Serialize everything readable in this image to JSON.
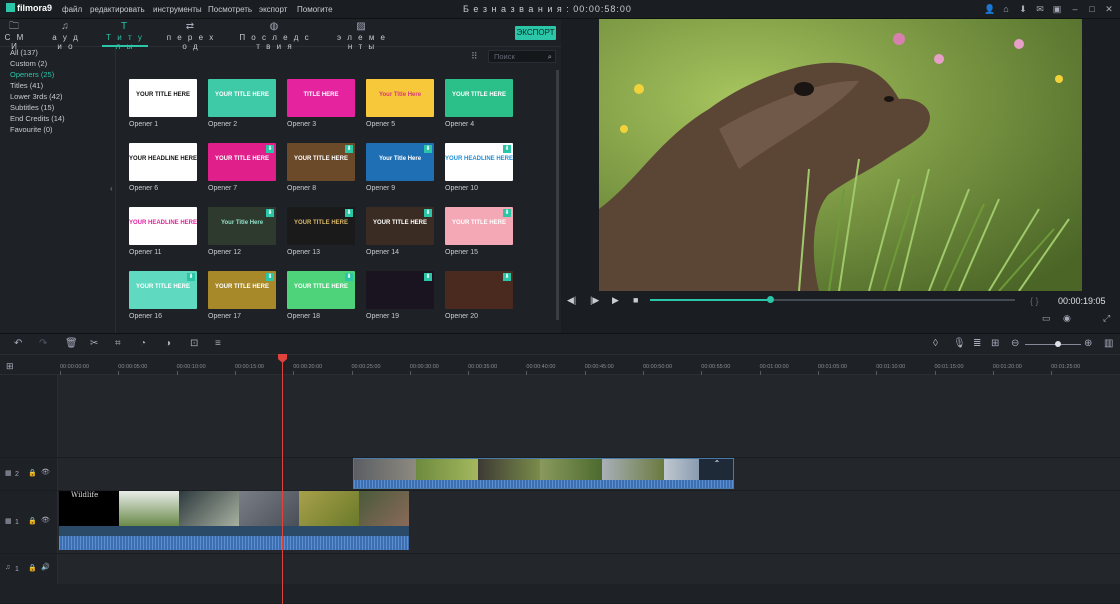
{
  "app": {
    "logo": "filmora9",
    "menu": [
      "файл",
      "редактировать",
      "инструменты",
      "Посмотреть",
      "экспорт",
      "Помогите"
    ],
    "window_title": "Б е з  н а з в а н и я : 00:00:58:00"
  },
  "library": {
    "tabs": [
      {
        "label": "С М И",
        "icon": "folder-icon"
      },
      {
        "label": "а у д и о",
        "icon": "music-note-icon"
      },
      {
        "label": "Т и т у л ы",
        "icon": "title-icon"
      },
      {
        "label": "п е р е х о д",
        "icon": "transition-icon"
      },
      {
        "label": "П о с л е д с т в и я",
        "icon": "effects-icon"
      },
      {
        "label": "э л е м е н т ы",
        "icon": "image-icon"
      }
    ],
    "active_tab": "Т и т у л ы",
    "export_button": "ЭКСПОРТ",
    "search_placeholder": "Поиск",
    "categories": [
      {
        "label": "All (137)",
        "selected": false
      },
      {
        "label": "Custom (2)",
        "selected": false
      },
      {
        "label": "Openers (25)",
        "selected": true
      },
      {
        "label": "Titles (41)",
        "selected": false
      },
      {
        "label": "Lower 3rds (42)",
        "selected": false
      },
      {
        "label": "Subtitles (15)",
        "selected": false
      },
      {
        "label": "End Credits (14)",
        "selected": false
      },
      {
        "label": "Favourite (0)",
        "selected": false
      }
    ],
    "items": [
      {
        "label": "Opener 1",
        "text": "YOUR TITLE HERE",
        "bg": "#ffffff",
        "fg": "#111111",
        "download": false
      },
      {
        "label": "Opener 2",
        "text": "YOUR TITLE HERE",
        "bg": "#3ec9a7",
        "fg": "#ffffff",
        "download": false
      },
      {
        "label": "Opener 3",
        "text": "TITLE HERE",
        "bg": "#e5239f",
        "fg": "#ffffff",
        "download": false
      },
      {
        "label": "Opener 5",
        "text": "Your Title Here",
        "bg": "#f7c83a",
        "fg": "#d63a7a",
        "download": false
      },
      {
        "label": "Opener 4",
        "text": "YOUR TITLE HERE",
        "bg": "#2bbf8a",
        "fg": "#ffffff",
        "download": false
      },
      {
        "label": "Opener 6",
        "text": "YOUR HEADLINE HERE",
        "bg": "#ffffff",
        "fg": "#111111",
        "download": false
      },
      {
        "label": "Opener 7",
        "text": "YOUR TITLE HERE",
        "bg": "#e01f8a",
        "fg": "#ffffff",
        "download": true
      },
      {
        "label": "Opener 8",
        "text": "YOUR TITLE HERE",
        "bg": "#6b4a2a",
        "fg": "#ffffff",
        "download": true
      },
      {
        "label": "Opener 9",
        "text": "Your Title Here",
        "bg": "#1f6fb5",
        "fg": "#ffffff",
        "download": true
      },
      {
        "label": "Opener 10",
        "text": "YOUR HEADLINE HERE",
        "bg": "#ffffff",
        "fg": "#1f8fd6",
        "download": true
      },
      {
        "label": "Opener 11",
        "text": "YOUR HEADLINE HERE",
        "bg": "#ffffff",
        "fg": "#e0239f",
        "download": false
      },
      {
        "label": "Opener 12",
        "text": "Your Title Here",
        "bg": "#2f3a2e",
        "fg": "#8fe0c8",
        "download": true
      },
      {
        "label": "Opener 13",
        "text": "YOUR TITLE HERE",
        "bg": "#1a1a1a",
        "fg": "#d8b86a",
        "download": true
      },
      {
        "label": "Opener 14",
        "text": "YOUR TITLE HERE",
        "bg": "#3a2c22",
        "fg": "#ffffff",
        "download": true
      },
      {
        "label": "Opener 15",
        "text": "YOUR TITLE HERE",
        "bg": "#f4a7b5",
        "fg": "#ffffff",
        "download": true
      },
      {
        "label": "Opener 16",
        "text": "YOUR TITLE HERE",
        "bg": "#5fd9c0",
        "fg": "#ffffff",
        "download": true
      },
      {
        "label": "Opener 17",
        "text": "YOUR TITLE HERE",
        "bg": "#a8892a",
        "fg": "#ffffff",
        "download": true
      },
      {
        "label": "Opener 18",
        "text": "YOUR TITLE HERE",
        "bg": "#4ed27a",
        "fg": "#ffffff",
        "download": true
      },
      {
        "label": "Opener 19",
        "text": "",
        "bg": "#1a1420",
        "fg": "#c040ff",
        "download": true
      },
      {
        "label": "Opener 20",
        "text": "",
        "bg": "#4a2a1e",
        "fg": "#ffffff",
        "download": true
      }
    ]
  },
  "preview": {
    "timecode": "00:00:19:05",
    "brackets": "{  }",
    "progress_fraction": 0.33,
    "buttons": [
      "prev-frame-icon",
      "play-from-icon",
      "play-icon",
      "stop-icon"
    ],
    "icons": [
      "screen-icon",
      "camera-icon",
      "fullscreen-icon"
    ]
  },
  "timeline": {
    "ruler": [
      "00:00:00:00",
      "00:00:05:00",
      "00:00:10:00",
      "00:00:15:00",
      "00:00:20:00",
      "00:00:25:00",
      "00:00:30:00",
      "00:00:35:00",
      "00:00:40:00",
      "00:00:45:00",
      "00:00:50:00",
      "00:00:55:00",
      "00:01:00:00",
      "00:01:05:00",
      "00:01:10:00",
      "00:01:15:00",
      "00:01:20:00",
      "00:01:25:00"
    ],
    "tracks": [
      {
        "num": "2",
        "type": "video"
      },
      {
        "num": "1",
        "type": "video"
      },
      {
        "num": "1",
        "type": "audio"
      }
    ],
    "clip_title": "Wildlife"
  },
  "colors": {
    "accent": "#2bc5a8",
    "playhead": "#e0433c"
  }
}
